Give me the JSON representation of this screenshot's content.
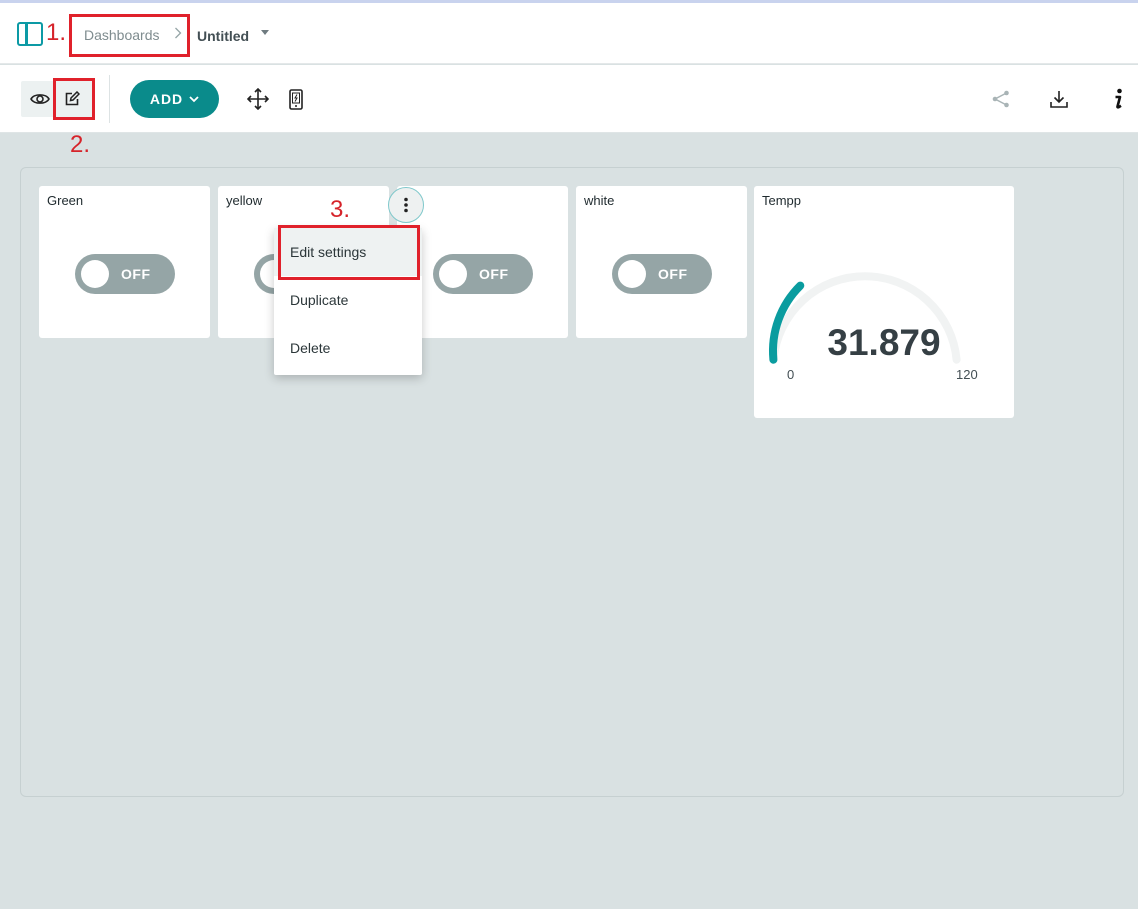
{
  "annotations": {
    "step1": "1.",
    "step2": "2.",
    "step3": "3."
  },
  "header": {
    "breadcrumb": "Dashboards",
    "breadcrumb_separator": ">",
    "title": "Untitled"
  },
  "toolbar": {
    "add_label": "ADD",
    "icons": [
      "eye-icon",
      "pencil-icon",
      "move-icon",
      "mobile-view-icon",
      "share-icon",
      "download-icon",
      "info-icon"
    ]
  },
  "widgets": [
    {
      "title": "Green",
      "state": "OFF"
    },
    {
      "title": "yellow",
      "state": "OFF"
    },
    {
      "title": "",
      "state": "OFF"
    },
    {
      "title": "white",
      "state": "OFF"
    }
  ],
  "gauge": {
    "title": "Tempp",
    "value": "31.879",
    "min": "0",
    "max": "120",
    "fraction": 0.2657
  },
  "context_menu": {
    "items": [
      "Edit settings",
      "Duplicate",
      "Delete"
    ]
  },
  "colors": {
    "accent": "#0a8b8b",
    "annotation": "#e0212b",
    "switch_off": "#95a5a6",
    "background": "#d9e1e2"
  }
}
